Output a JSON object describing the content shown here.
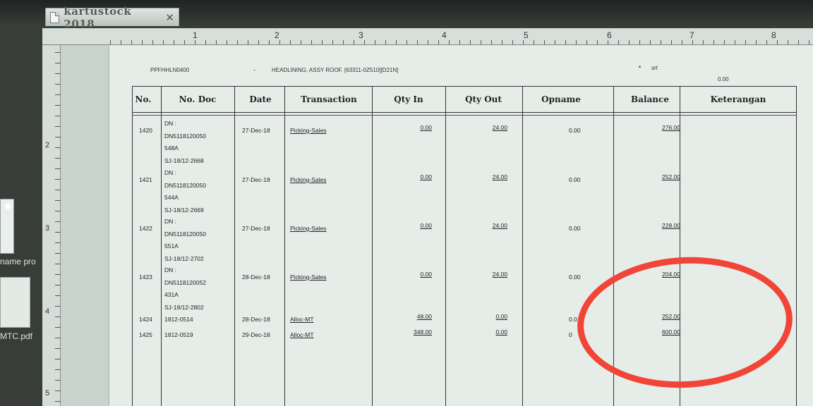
{
  "window": {
    "tab_title": "kartustock 2018",
    "tab_close": "✕",
    "tab_icon": "document-icon"
  },
  "left_panel": {
    "item1_label": "name pro",
    "item2_label": "MTC.pdf"
  },
  "ruler": {
    "h_numbers": [
      "1",
      "2",
      "3",
      "4",
      "5",
      "6",
      "7",
      "8"
    ],
    "v_numbers": [
      "2",
      "3",
      "4",
      "5"
    ]
  },
  "report_header": {
    "item_code": "PPFHHLN0400",
    "dash": "-",
    "item_desc": "HEADLINING, ASSY ROOF. [63311-0Z510][D21N]",
    "bullet": "•",
    "srt": "srt",
    "zero": "0.00"
  },
  "table": {
    "columns": [
      "No.",
      "No. Doc",
      "Date",
      "Transaction",
      "Qty In",
      "Qty Out",
      "Opname",
      "Balance",
      "Keterangan"
    ],
    "rows": [
      {
        "no": "1420",
        "doc": [
          "DN :",
          "DN5118120050",
          "548A",
          "SJ-18/12-2668"
        ],
        "date": "27-Dec-18",
        "transaction": "Picking-Sales",
        "qty_in": "0.00",
        "qty_out": "24.00",
        "opname": "0.00",
        "balance": "276.00"
      },
      {
        "no": "1421",
        "doc": [
          "DN :",
          "DN5118120050",
          "544A",
          "SJ-18/12-2669"
        ],
        "date": "27-Dec-18",
        "transaction": "Picking-Sales",
        "qty_in": "0.00",
        "qty_out": "24.00",
        "opname": "0.00",
        "balance": "252.00"
      },
      {
        "no": "1422",
        "doc": [
          "DN :",
          "DN5118120050",
          "551A",
          "SJ-18/12-2702"
        ],
        "date": "27-Dec-18",
        "transaction": "Picking-Sales",
        "qty_in": "0.00",
        "qty_out": "24.00",
        "opname": "0.00",
        "balance": "228.00"
      },
      {
        "no": "1423",
        "doc": [
          "DN :",
          "DN5118120052",
          "431A",
          "SJ-18/12-2802"
        ],
        "date": "28-Dec-18",
        "transaction": "Picking-Sales",
        "qty_in": "0.00",
        "qty_out": "24.00",
        "opname": "0.00",
        "balance": "204.00"
      },
      {
        "no": "1424",
        "doc": [
          "1812-0514"
        ],
        "date": "28-Dec-18",
        "transaction": "Alloc-MT",
        "qty_in": "48.00",
        "qty_out": "0.00",
        "opname": "0.0",
        "balance": "252.00"
      },
      {
        "no": "1425",
        "doc": [
          "1812-0519"
        ],
        "date": "29-Dec-18",
        "transaction": "Alloc-MT",
        "qty_in": "348.00",
        "qty_out": "0.00",
        "opname": "0",
        "balance": "600.00"
      }
    ]
  },
  "colors": {
    "highlight": "#f04537",
    "page": "#e6ede9"
  }
}
